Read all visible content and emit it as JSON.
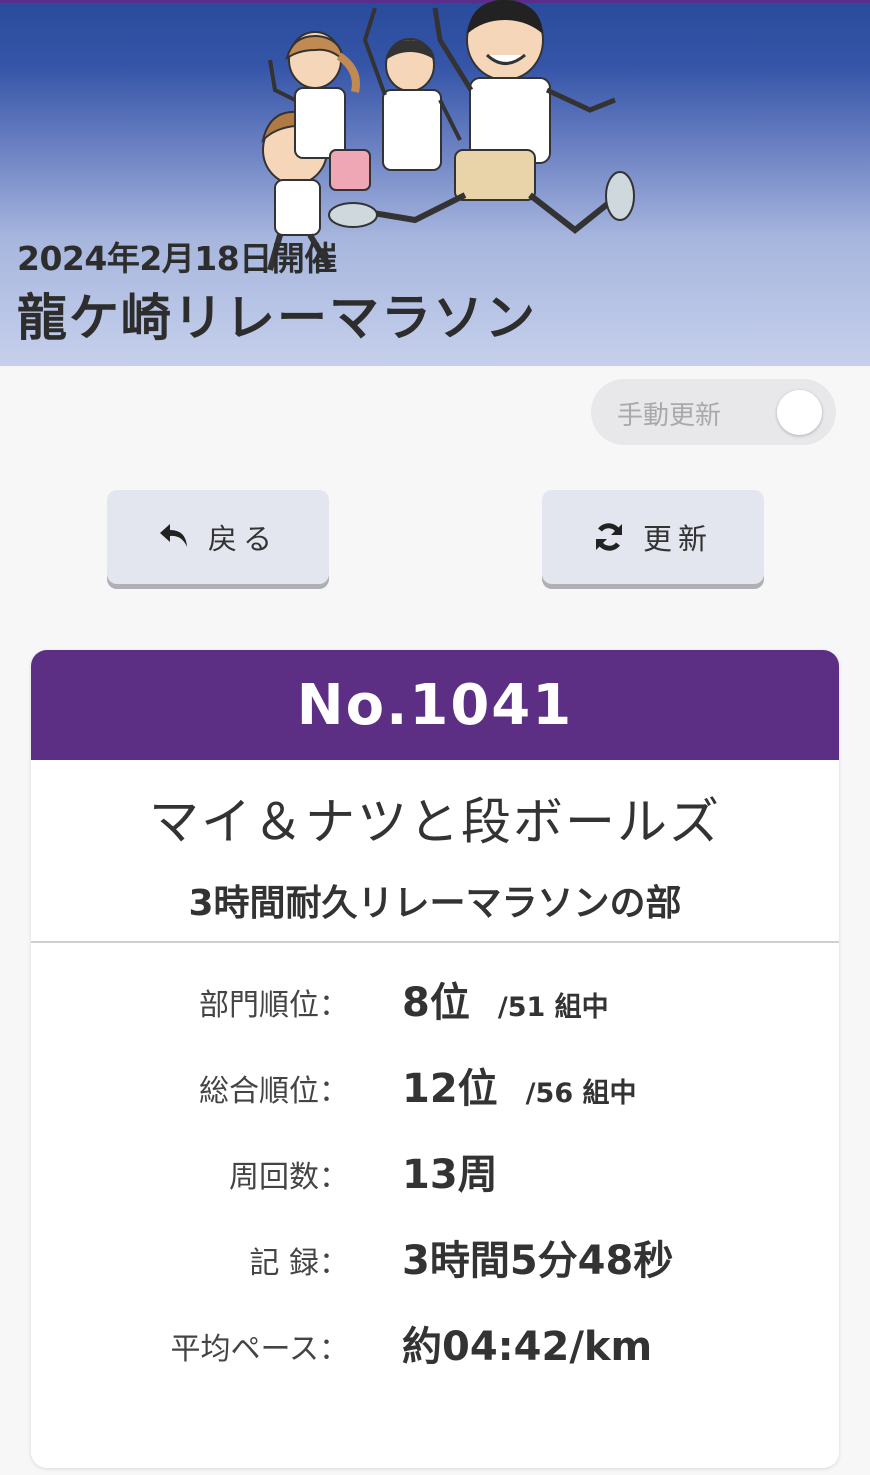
{
  "header": {
    "event_date": "2024年2月18日開催",
    "event_title": "龍ケ崎リレーマラソン"
  },
  "toggle": {
    "label": "手動更新",
    "state": "off"
  },
  "buttons": {
    "back": {
      "icon": "undo-arrow-icon",
      "label": "戻る"
    },
    "refresh": {
      "icon": "sync-icon",
      "label": "更新"
    }
  },
  "result": {
    "number": "No.1041",
    "team_name": "マイ＆ナツと段ボールズ",
    "division": "3時間耐久リレーマラソンの部",
    "rows": [
      {
        "label": "部門順位：",
        "value": "8位",
        "sub": "/51 組中"
      },
      {
        "label": "総合順位：",
        "value": "12位",
        "sub": "/56 組中"
      },
      {
        "label": "周回数：",
        "value": "13周"
      },
      {
        "label": "記 録：",
        "value": "3時間5分48秒"
      },
      {
        "label": "平均ペース：",
        "value": "約04:42/km"
      }
    ]
  },
  "colors": {
    "accent": "#5c2e84",
    "header_top": "#2a4a9c",
    "button_bg": "#e3e6ef"
  }
}
